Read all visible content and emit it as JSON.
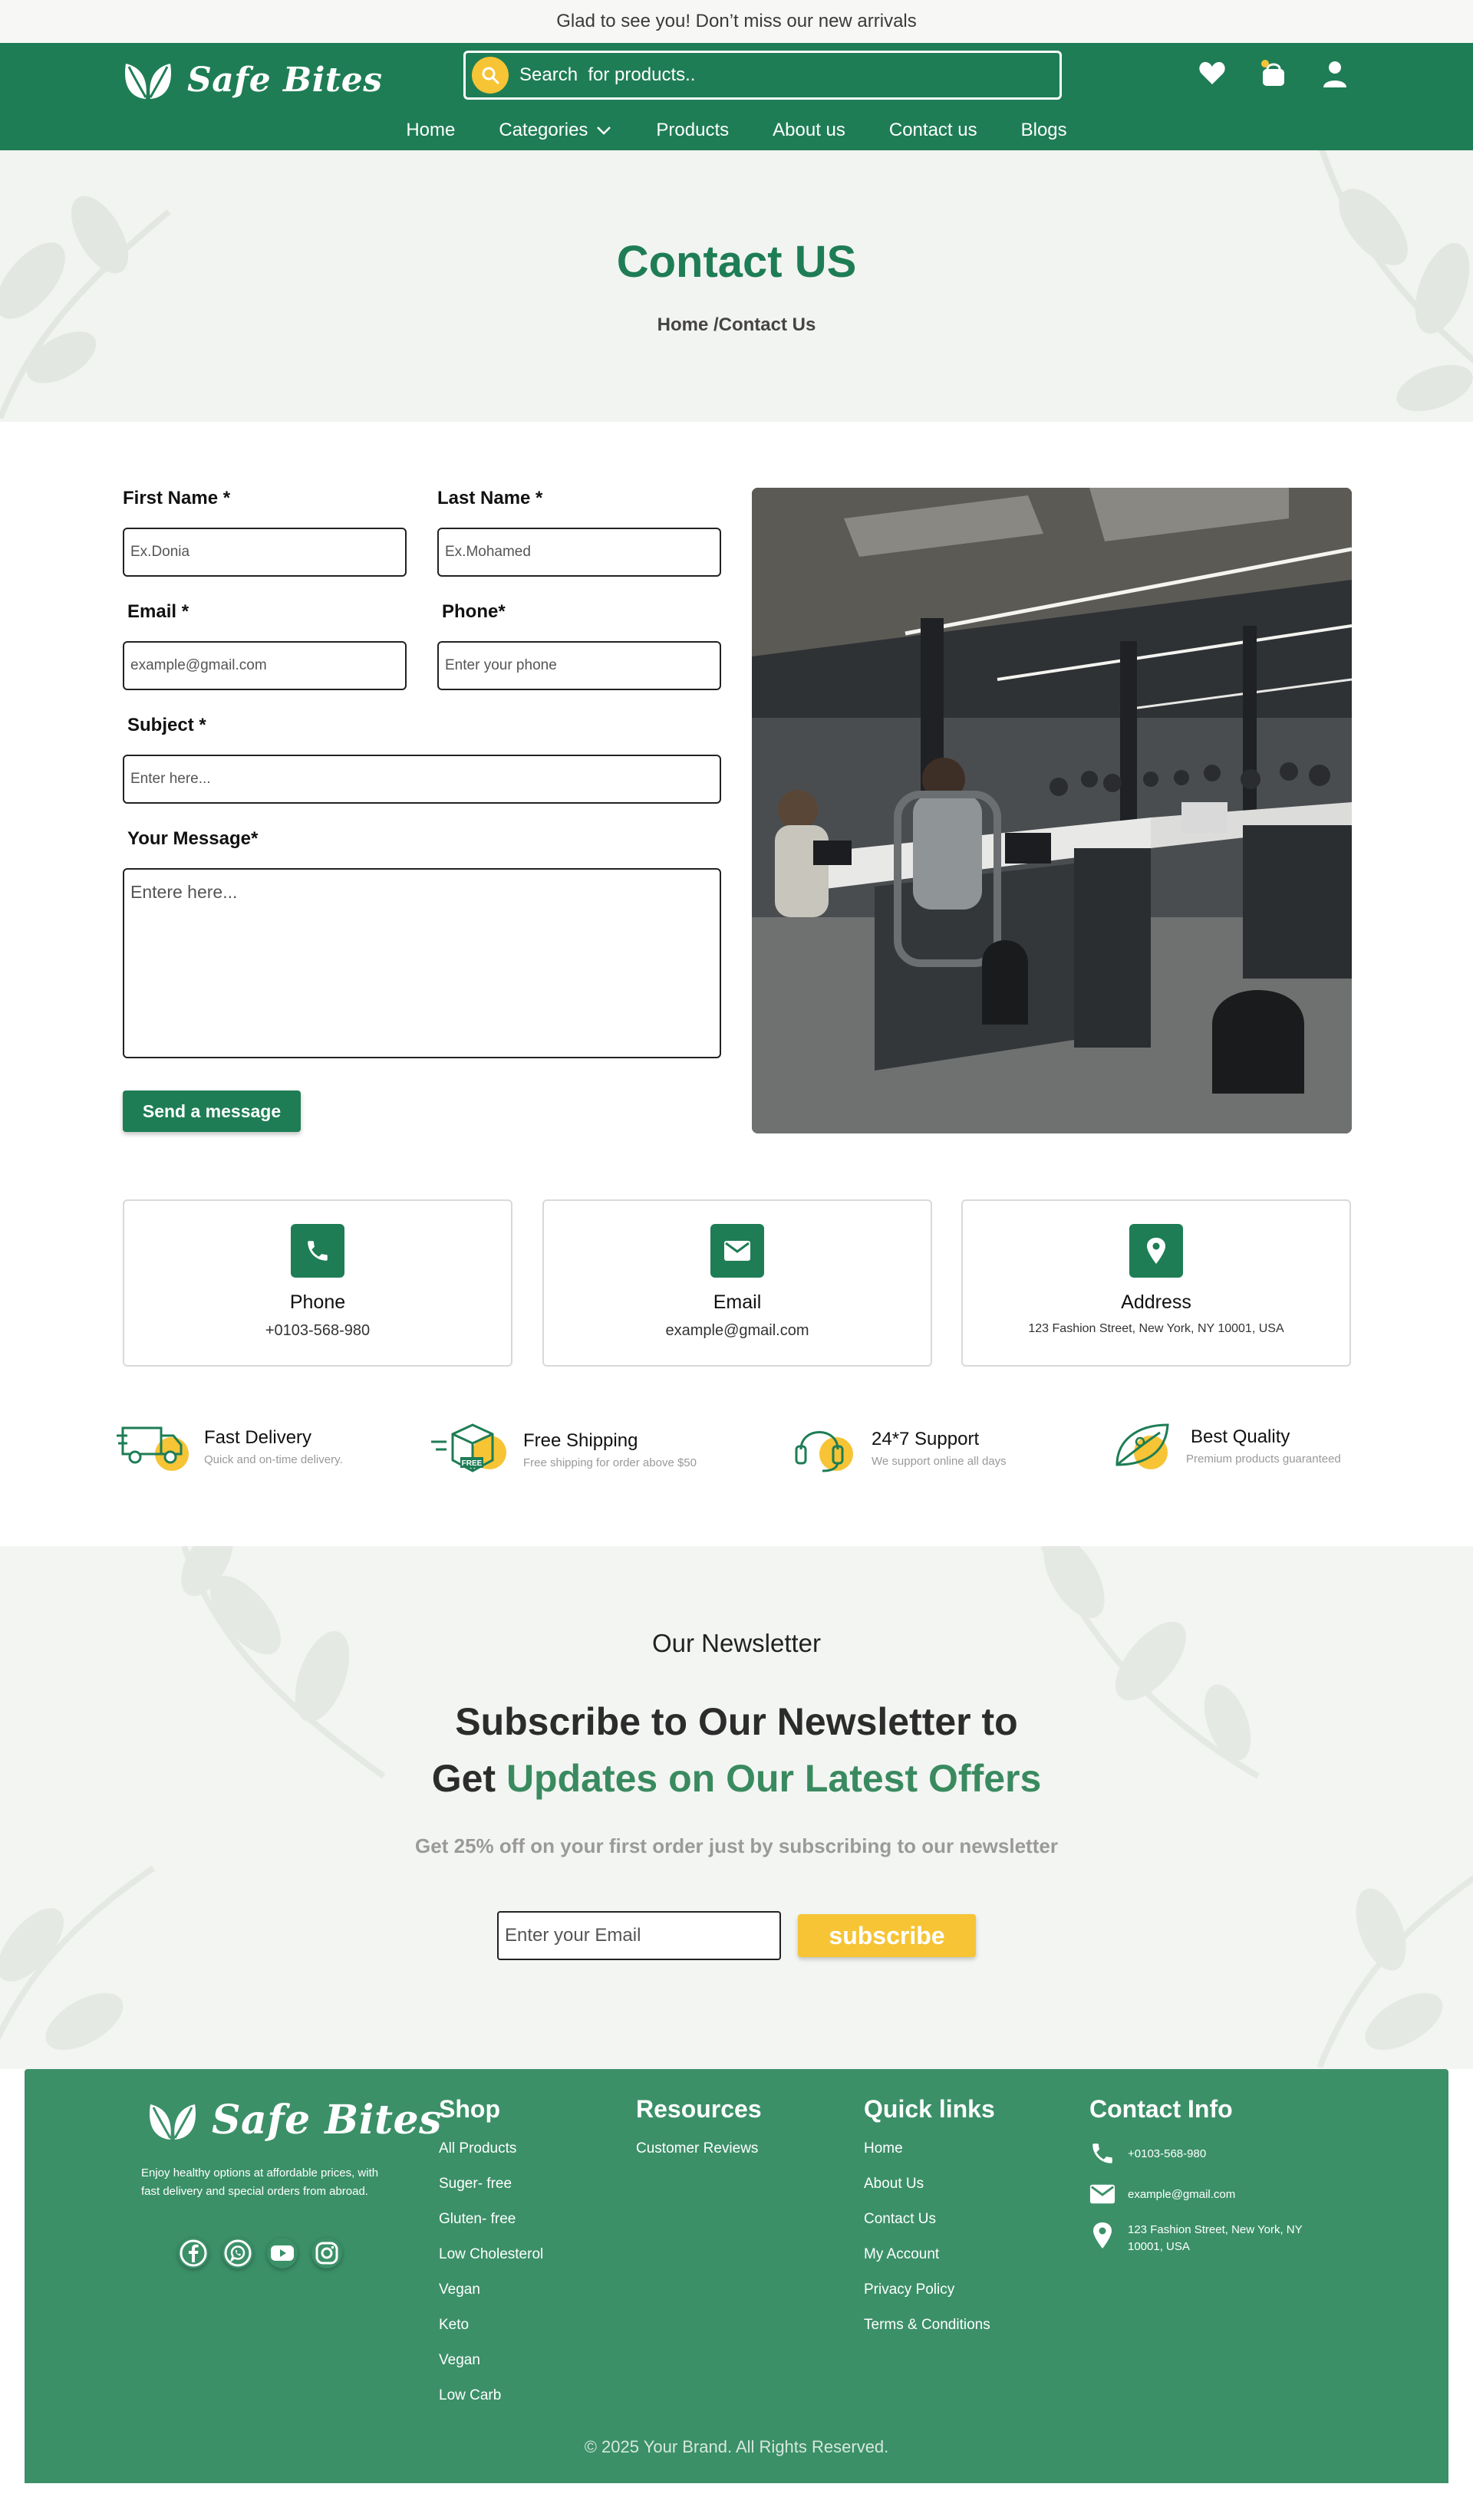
{
  "topbar": {
    "message": "Glad to see you! Don’t miss our new arrivals"
  },
  "brand": {
    "name": "Safe Bites",
    "primary_color": "#1e7d55",
    "accent_color": "#f6c435",
    "footer_color": "#3b9068"
  },
  "search": {
    "placeholder": "Search  for products.."
  },
  "header_icons": [
    "heart-icon",
    "cart-icon",
    "user-icon"
  ],
  "nav": {
    "home": "Home",
    "categories": "Categories",
    "products": "Products",
    "about": "About us",
    "contact": "Contact us",
    "blogs": "Blogs"
  },
  "hero": {
    "title": "Contact US",
    "breadcrumb": "Home /Contact Us"
  },
  "form": {
    "first_name_label": "First Name *",
    "first_name_placeholder": "Ex.Donia",
    "last_name_label": "Last Name *",
    "last_name_placeholder": "Ex.Mohamed",
    "email_label": "Email *",
    "email_placeholder": "example@gmail.com",
    "phone_label": "Phone*",
    "phone_placeholder": "Enter your phone",
    "subject_label": "Subject *",
    "subject_placeholder": "Enter here...",
    "message_label": "Your Message*",
    "message_placeholder": "Entere here...",
    "submit": "Send a message"
  },
  "contact_cards": [
    {
      "title": "Phone",
      "value": "+0103-568-980",
      "icon": "phone-icon"
    },
    {
      "title": "Email",
      "value": "example@gmail.com",
      "icon": "mail-icon"
    },
    {
      "title": "Address",
      "value": "123 Fashion Street, New York, NY 10001, USA",
      "icon": "location-pin-icon"
    }
  ],
  "features": [
    {
      "title": "Fast Delivery",
      "subtitle": "Quick and on-time delivery.",
      "icon": "truck-icon"
    },
    {
      "title": "Free Shipping",
      "subtitle": "Free shipping for order above $50",
      "icon": "free-box-icon"
    },
    {
      "title": "24*7 Support",
      "subtitle": "We support online all days",
      "icon": "headset-icon"
    },
    {
      "title": "Best Quality",
      "subtitle": "Premium products guaranteed",
      "icon": "leaf-quality-icon"
    }
  ],
  "newsletter": {
    "overline": "Our Newsletter",
    "title_line1": "Subscribe to Our Newsletter to",
    "title_line2_plain": "Get ",
    "title_line2_highlight": "Updates on Our Latest Offers",
    "subtitle": "Get 25% off on your first order just by subscribing to our newsletter",
    "email_placeholder": "Enter your Email",
    "button": "subscribe"
  },
  "footer": {
    "description": "Enjoy healthy options at affordable prices, with fast delivery and special orders from abroad.",
    "socials": [
      "facebook-icon",
      "whatsapp-icon",
      "youtube-icon",
      "instagram-icon"
    ],
    "shop": {
      "title": "Shop",
      "items": [
        "All Products",
        "Suger- free",
        "Gluten- free",
        "Low Cholesterol",
        "Vegan",
        "Keto",
        "Vegan",
        "Low Carb"
      ]
    },
    "resources": {
      "title": "Resources",
      "items": [
        "Customer Reviews"
      ]
    },
    "quick_links": {
      "title": "Quick links",
      "items": [
        "Home",
        "About Us",
        "Contact Us",
        "My Account",
        "Privacy Policy",
        "Terms & Conditions"
      ]
    },
    "contact_info": {
      "title": "Contact Info",
      "phone": "+0103-568-980",
      "email": "example@gmail.com",
      "address": "123 Fashion Street, New York, NY 10001, USA"
    },
    "copyright": "© 2025 Your Brand. All Rights Reserved."
  }
}
